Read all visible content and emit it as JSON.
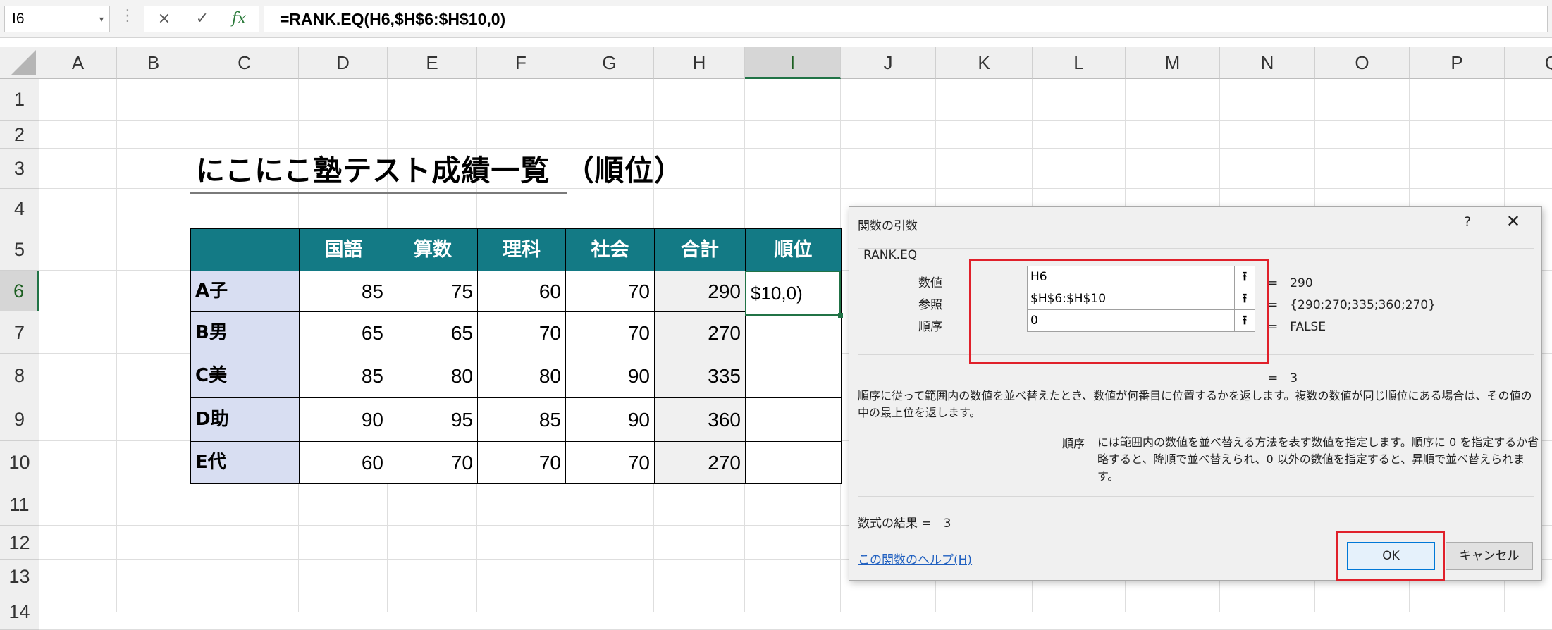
{
  "formula_bar": {
    "name_box": "I6",
    "cancel_icon": "×",
    "enter_icon": "✓",
    "fx_label": "fx",
    "formula": "=RANK.EQ(H6,$H$6:$H$10,0)"
  },
  "grid": {
    "columns": [
      "A",
      "B",
      "C",
      "D",
      "E",
      "F",
      "G",
      "H",
      "I",
      "J",
      "K",
      "L",
      "M",
      "N",
      "O",
      "P",
      "Q"
    ],
    "rows": [
      "1",
      "2",
      "3",
      "4",
      "5",
      "6",
      "7",
      "8",
      "9",
      "10",
      "11",
      "12",
      "13",
      "14"
    ],
    "selected_column": "I",
    "selected_row": "6"
  },
  "sheet": {
    "title": "にこにこ塾テスト成績一覧　（順位）",
    "headers": [
      "国語",
      "算数",
      "理科",
      "社会",
      "合計",
      "順位"
    ],
    "students": [
      {
        "name": "A子",
        "scores": [
          "85",
          "75",
          "60",
          "70"
        ],
        "total": "290"
      },
      {
        "name": "B男",
        "scores": [
          "65",
          "65",
          "70",
          "70"
        ],
        "total": "270"
      },
      {
        "name": "C美",
        "scores": [
          "85",
          "80",
          "80",
          "90"
        ],
        "total": "335"
      },
      {
        "name": "D助",
        "scores": [
          "90",
          "95",
          "85",
          "90"
        ],
        "total": "360"
      },
      {
        "name": "E代",
        "scores": [
          "60",
          "70",
          "70",
          "70"
        ],
        "total": "270"
      }
    ],
    "active_cell_text": "$10,0)"
  },
  "dialog": {
    "title": "関数の引数",
    "help_icon": "?",
    "close_icon": "✕",
    "function_name": "RANK.EQ",
    "args": [
      {
        "label": "数値",
        "value": "H6",
        "result": "=　290"
      },
      {
        "label": "参照",
        "value": "$H$6:$H$10",
        "result": "=　{290;270;335;360;270}"
      },
      {
        "label": "順序",
        "value": "0",
        "result": "=　FALSE"
      }
    ],
    "overall_result": "=　3",
    "description": "順序に従って範囲内の数値を並べ替えたとき、数値が何番目に位置するかを返します。複数の数値が同じ順位にある場合は、その値の中の最上位を返します。",
    "arg_desc_name": "順序",
    "arg_desc": "には範囲内の数値を並べ替える方法を表す数値を指定します。順序に 0 を指定するか省略すると、降順で並べ替えられ、0 以外の数値を指定すると、昇順で並べ替えられます。",
    "formula_result_label": "数式の結果 =　3",
    "help_link": "この関数のヘルプ(H)",
    "ok_label": "OK",
    "cancel_label": "キャンセル",
    "collapse_icon": "⭱",
    "accent_red": "#e0202a",
    "accent_blue": "#0078d7"
  },
  "colors": {
    "header_teal": "#137a85",
    "name_col_blue": "#d8def2",
    "excel_green": "#217346"
  }
}
